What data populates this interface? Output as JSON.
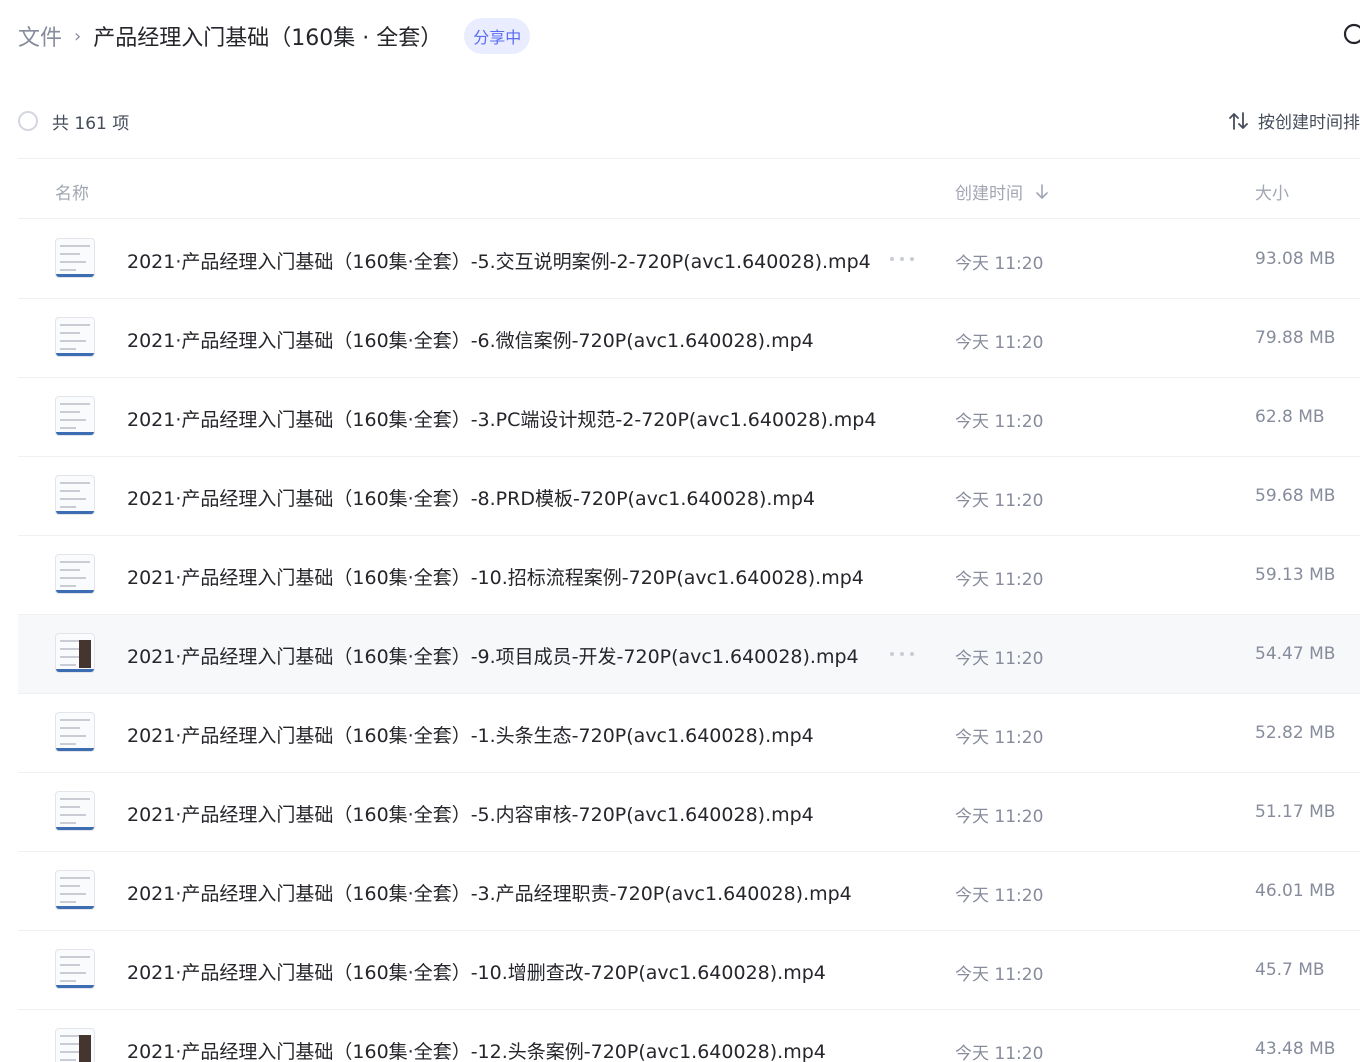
{
  "header": {
    "breadcrumb_root": "文件",
    "breadcrumb_sep": "›",
    "breadcrumb_current": "产品经理入门基础（160集 · 全套）",
    "share_badge": "分享中"
  },
  "toolbar": {
    "count_text": "共 161 项",
    "sort_label": "按创建时间排序"
  },
  "columns": {
    "name": "名称",
    "time": "创建时间",
    "size": "大小"
  },
  "files": [
    {
      "name": "2021·产品经理入门基础（160集·全套）-5.交互说明案例-2-720P(avc1.640028).mp4",
      "time": "今天 11:20",
      "size": "93.08 MB"
    },
    {
      "name": "2021·产品经理入门基础（160集·全套）-6.微信案例-720P(avc1.640028).mp4",
      "time": "今天 11:20",
      "size": "79.88 MB"
    },
    {
      "name": "2021·产品经理入门基础（160集·全套）-3.PC端设计规范-2-720P(avc1.640028).mp4",
      "time": "今天 11:20",
      "size": "62.8 MB"
    },
    {
      "name": "2021·产品经理入门基础（160集·全套）-8.PRD模板-720P(avc1.640028).mp4",
      "time": "今天 11:20",
      "size": "59.68 MB"
    },
    {
      "name": "2021·产品经理入门基础（160集·全套）-10.招标流程案例-720P(avc1.640028).mp4",
      "time": "今天 11:20",
      "size": "59.13 MB"
    },
    {
      "name": "2021·产品经理入门基础（160集·全套）-9.项目成员-开发-720P(avc1.640028).mp4",
      "time": "今天 11:20",
      "size": "54.47 MB"
    },
    {
      "name": "2021·产品经理入门基础（160集·全套）-1.头条生态-720P(avc1.640028).mp4",
      "time": "今天 11:20",
      "size": "52.82 MB"
    },
    {
      "name": "2021·产品经理入门基础（160集·全套）-5.内容审核-720P(avc1.640028).mp4",
      "time": "今天 11:20",
      "size": "51.17 MB"
    },
    {
      "name": "2021·产品经理入门基础（160集·全套）-3.产品经理职责-720P(avc1.640028).mp4",
      "time": "今天 11:20",
      "size": "46.01 MB"
    },
    {
      "name": "2021·产品经理入门基础（160集·全套）-10.增删查改-720P(avc1.640028).mp4",
      "time": "今天 11:20",
      "size": "45.7 MB"
    },
    {
      "name": "2021·产品经理入门基础（160集·全套）-12.头条案例-720P(avc1.640028).mp4",
      "time": "今天 11:20",
      "size": "43.48 MB"
    }
  ],
  "icons": {
    "search": "search-icon",
    "sort": "sort-arrows-icon",
    "sort_direction": "arrow-down-icon",
    "more": "more-icon",
    "file": "video-thumbnail-icon"
  },
  "colors": {
    "accent": "#5b6cf2",
    "badge_bg": "#e9edff",
    "muted_text": "#878c9c",
    "hover_row": "#f7f8fa"
  }
}
